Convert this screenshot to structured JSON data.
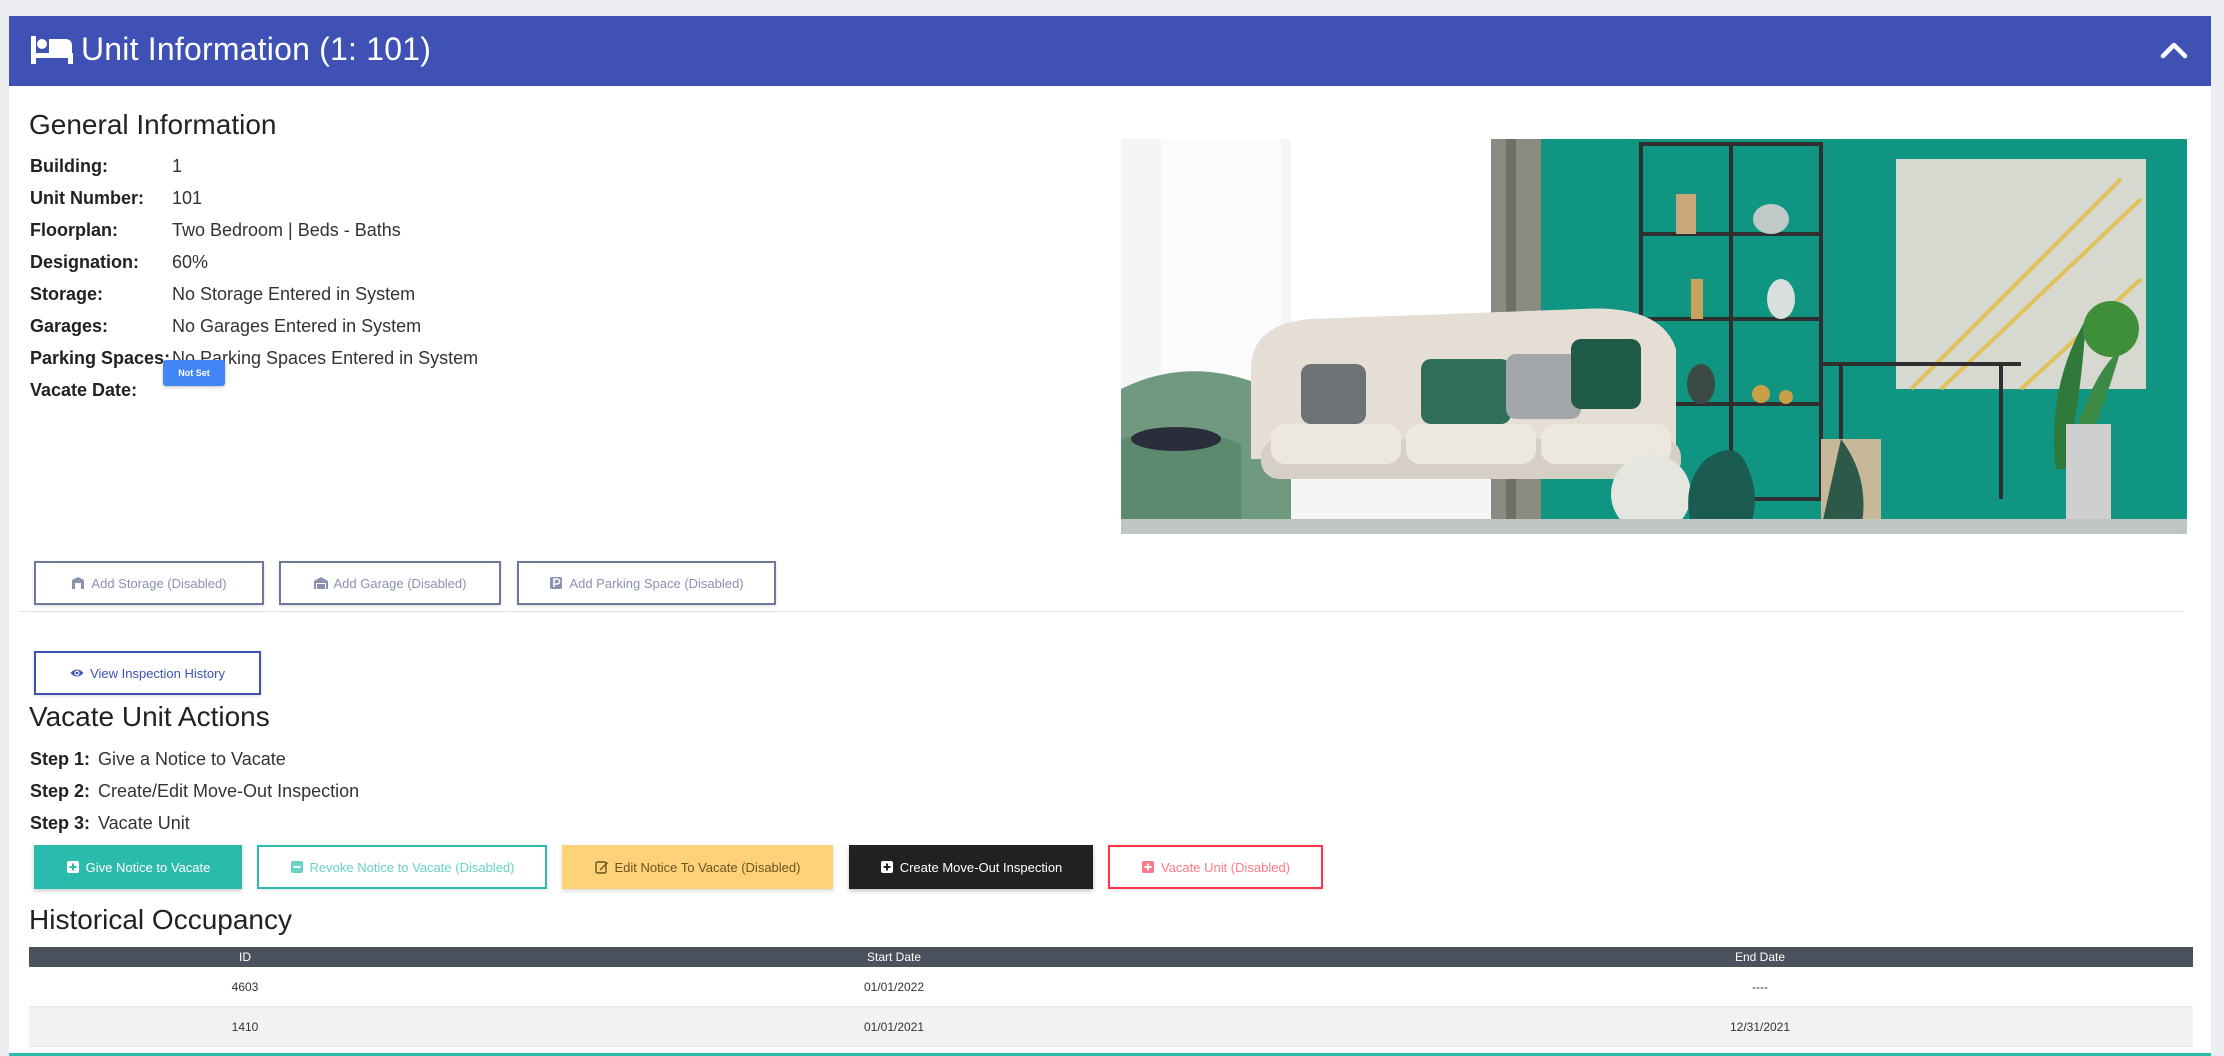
{
  "header": {
    "title": "Unit Information (1: 101)",
    "accent": "#3f51b5"
  },
  "general": {
    "heading": "General Information",
    "rows": [
      {
        "label": "Building:",
        "value": "1"
      },
      {
        "label": "Unit Number:",
        "value": "101"
      },
      {
        "label": "Floorplan:",
        "value": "Two Bedroom | Beds - Baths"
      },
      {
        "label": "Designation:",
        "value": "60%"
      },
      {
        "label": "Storage:",
        "value": "No Storage Entered in System"
      },
      {
        "label": "Garages:",
        "value": "No Garages Entered in System"
      },
      {
        "label": "Parking Spaces:",
        "value": "No Parking Spaces Entered in System"
      },
      {
        "label": "Vacate Date:",
        "value": ""
      }
    ],
    "vacate_badge": "Not Set"
  },
  "add_buttons": {
    "storage": "Add Storage (Disabled)",
    "garage": "Add Garage (Disabled)",
    "parking": "Add Parking Space (Disabled)"
  },
  "inspection_history_button": "View Inspection History",
  "vacate": {
    "heading": "Vacate Unit Actions",
    "steps": [
      {
        "label": "Step 1:",
        "value": "Give a Notice to Vacate"
      },
      {
        "label": "Step 2:",
        "value": "Create/Edit Move-Out Inspection"
      },
      {
        "label": "Step 3:",
        "value": "Vacate Unit"
      }
    ],
    "buttons": {
      "give_notice": "Give Notice to Vacate",
      "revoke_notice": "Revoke Notice to Vacate (Disabled)",
      "edit_notice": "Edit Notice To Vacate (Disabled)",
      "create_inspection": "Create Move-Out Inspection",
      "vacate_unit": "Vacate Unit (Disabled)"
    }
  },
  "history": {
    "heading": "Historical Occupancy",
    "columns": [
      "ID",
      "Start Date",
      "End Date"
    ],
    "rows": [
      [
        "4603",
        "01/01/2022",
        "----"
      ],
      [
        "1410",
        "01/01/2021",
        "12/31/2021"
      ]
    ]
  },
  "icons": {
    "header": "bed-icon",
    "collapse": "chevron-up-icon",
    "storage": "storage-icon",
    "garage": "garage-icon",
    "parking": "parking-icon",
    "view": "eye-icon",
    "plus": "plus-square-icon",
    "minus": "minus-square-icon",
    "edit": "edit-icon"
  }
}
